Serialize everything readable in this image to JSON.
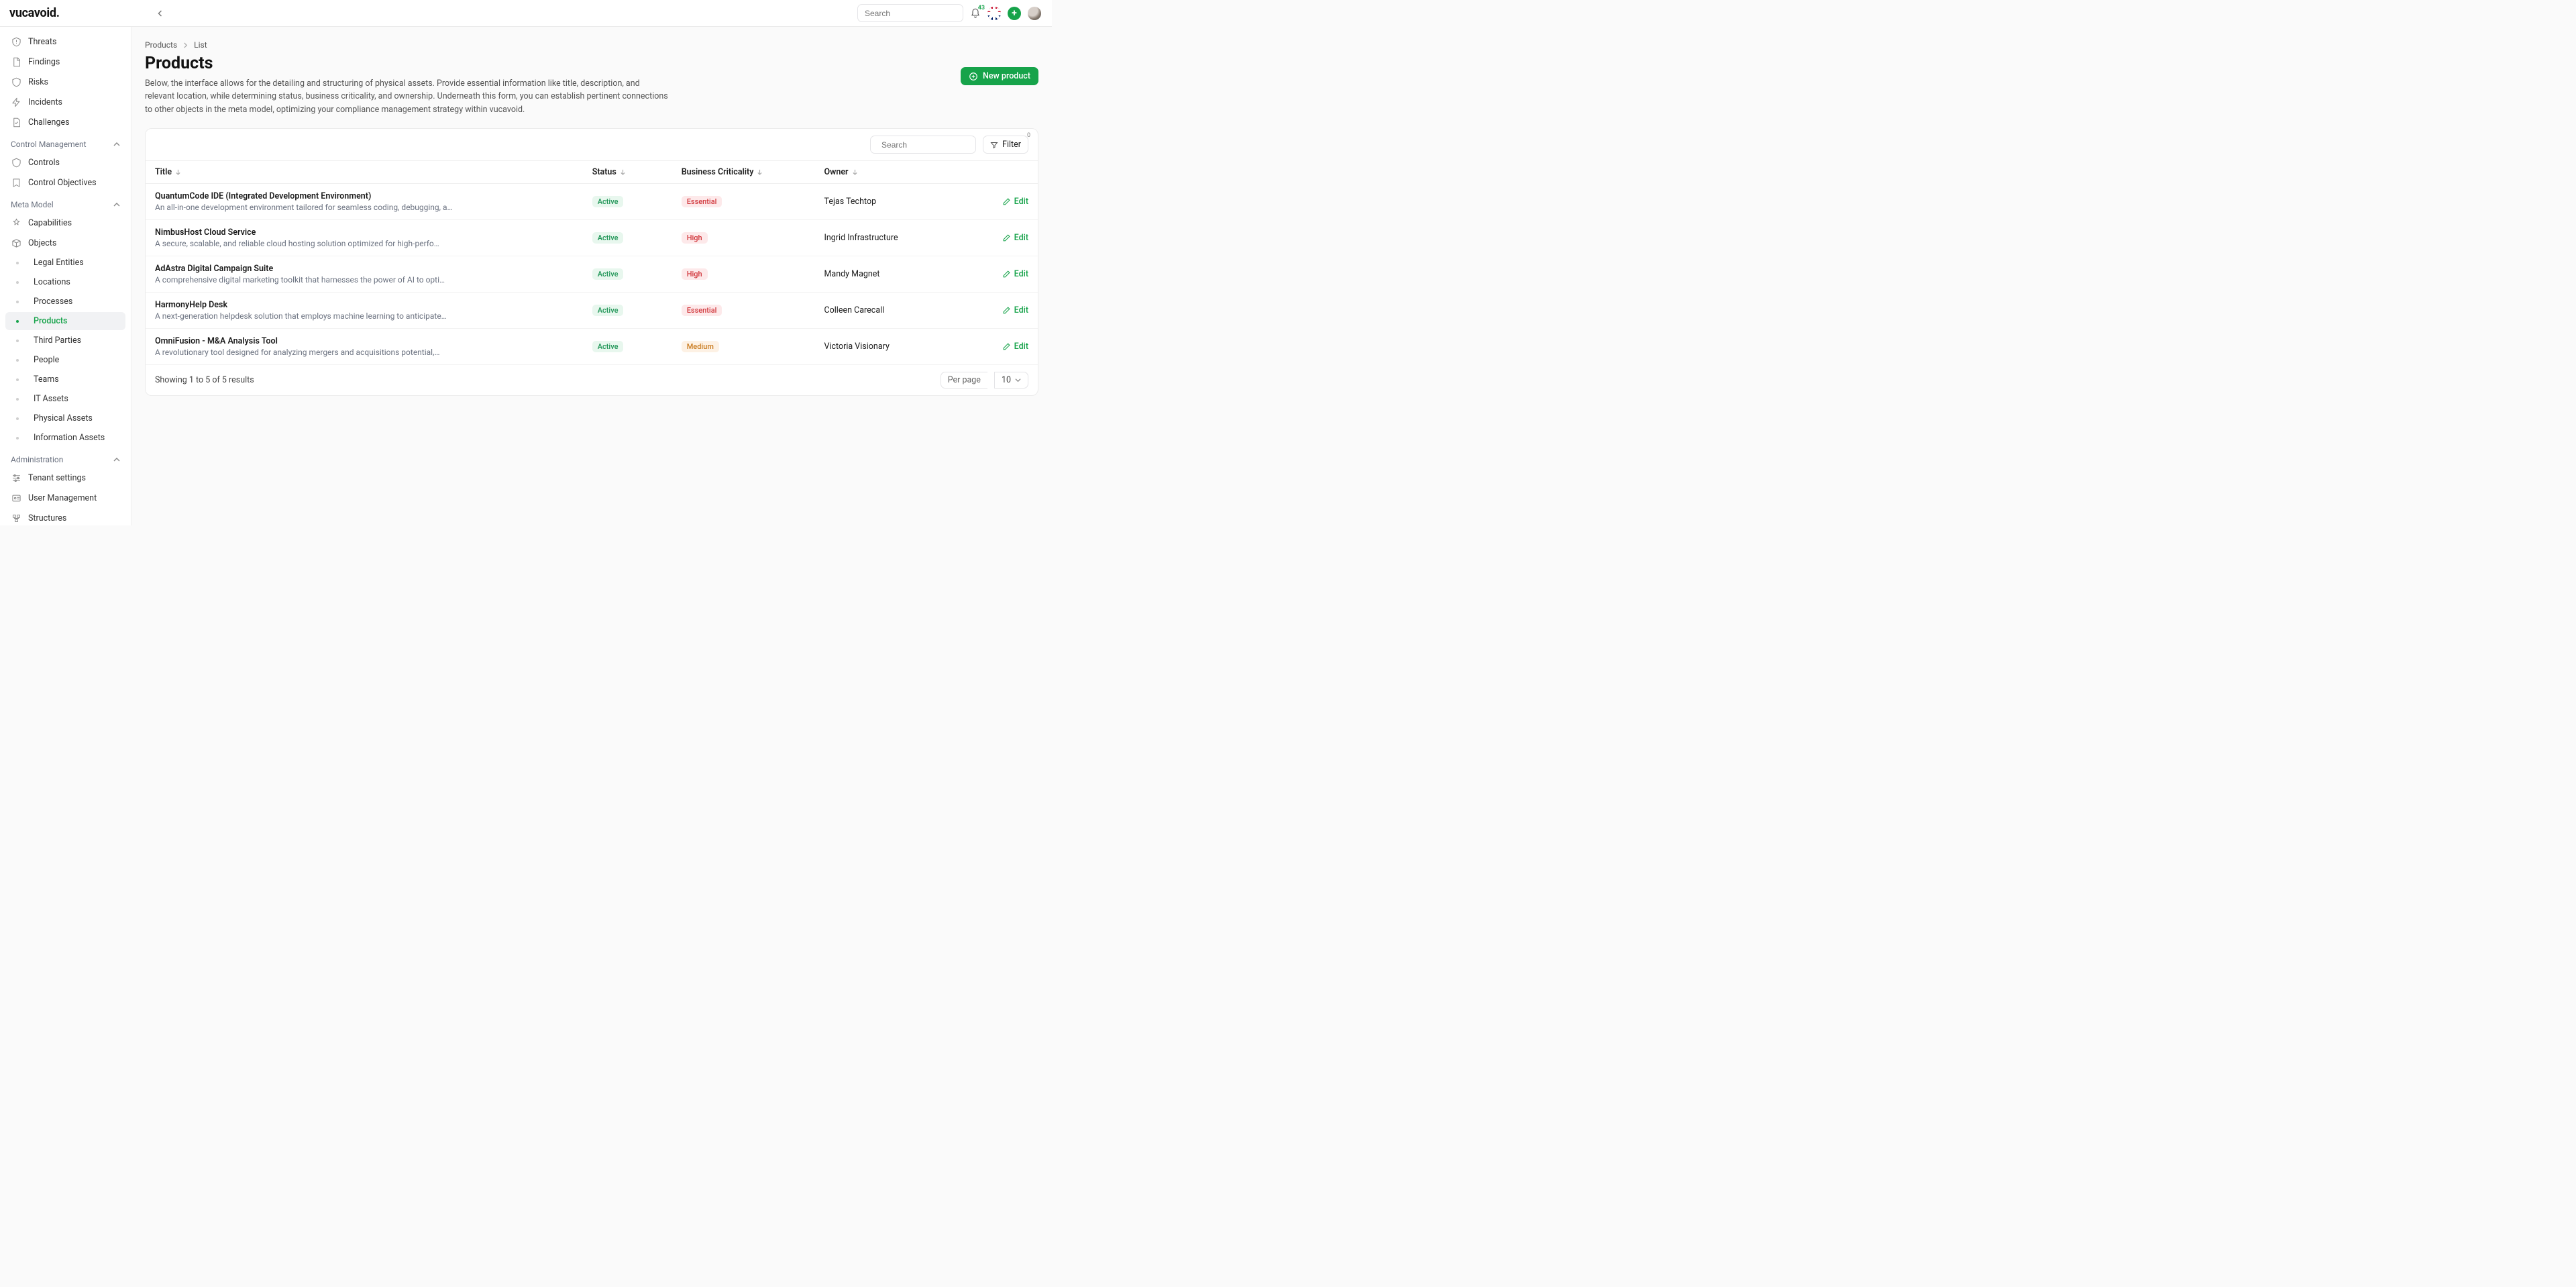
{
  "brand": "vucavoid",
  "global_search_placeholder": "Search",
  "notifications_count": "43",
  "sidebar": {
    "top_items": [
      "Threats",
      "Findings",
      "Risks",
      "Incidents",
      "Challenges"
    ],
    "section_control": "Control Management",
    "control_items": [
      "Controls",
      "Control Objectives"
    ],
    "section_meta": "Meta Model",
    "meta_items": [
      "Capabilities",
      "Objects"
    ],
    "meta_sub": [
      "Legal Entities",
      "Locations",
      "Processes",
      "Products",
      "Third Parties",
      "People",
      "Teams",
      "IT Assets",
      "Physical Assets",
      "Information Assets"
    ],
    "meta_sub_active_index": 3,
    "section_admin": "Administration",
    "admin_items": [
      "Tenant settings",
      "User Management",
      "Structures"
    ]
  },
  "breadcrumb": {
    "root": "Products",
    "leaf": "List"
  },
  "page": {
    "title": "Products",
    "description": "Below, the interface allows for the detailing and structuring of physical assets. Provide essential information like title, description, and relevant location, while determining status, business criticality, and ownership. Underneath this form, you can establish pertinent connections to other objects in the meta model, optimizing your compliance management strategy within vucavoid.",
    "new_button": "New product"
  },
  "table": {
    "search_placeholder": "Search",
    "filter_label": "Filter",
    "filter_count": "0",
    "columns": {
      "title": "Title",
      "status": "Status",
      "criticality": "Business Criticality",
      "owner": "Owner"
    },
    "edit_label": "Edit",
    "rows": [
      {
        "title": "QuantumCode IDE (Integrated Development Environment)",
        "desc": "An all-in-one development environment tailored for seamless coding, debugging, a…",
        "status": "Active",
        "criticality": "Essential",
        "crit_class": "pill-red",
        "owner": "Tejas Techtop"
      },
      {
        "title": "NimbusHost Cloud Service",
        "desc": "A secure, scalable, and reliable cloud hosting solution optimized for high-perfo…",
        "status": "Active",
        "criticality": "High",
        "crit_class": "pill-red",
        "owner": "Ingrid Infrastructure"
      },
      {
        "title": "AdAstra Digital Campaign Suite",
        "desc": "A comprehensive digital marketing toolkit that harnesses the power of AI to opti…",
        "status": "Active",
        "criticality": "High",
        "crit_class": "pill-red",
        "owner": "Mandy Magnet"
      },
      {
        "title": "HarmonyHelp Desk",
        "desc": "A next-generation helpdesk solution that employs machine learning to anticipate…",
        "status": "Active",
        "criticality": "Essential",
        "crit_class": "pill-red",
        "owner": "Colleen Carecall"
      },
      {
        "title": "OmniFusion - M&A Analysis Tool",
        "desc": "A revolutionary tool designed for analyzing mergers and acquisitions potential,…",
        "status": "Active",
        "criticality": "Medium",
        "crit_class": "pill-amber",
        "owner": "Victoria Visionary"
      }
    ],
    "footer_results": "Showing 1 to 5 of 5 results",
    "per_page_label": "Per page",
    "per_page_value": "10"
  }
}
